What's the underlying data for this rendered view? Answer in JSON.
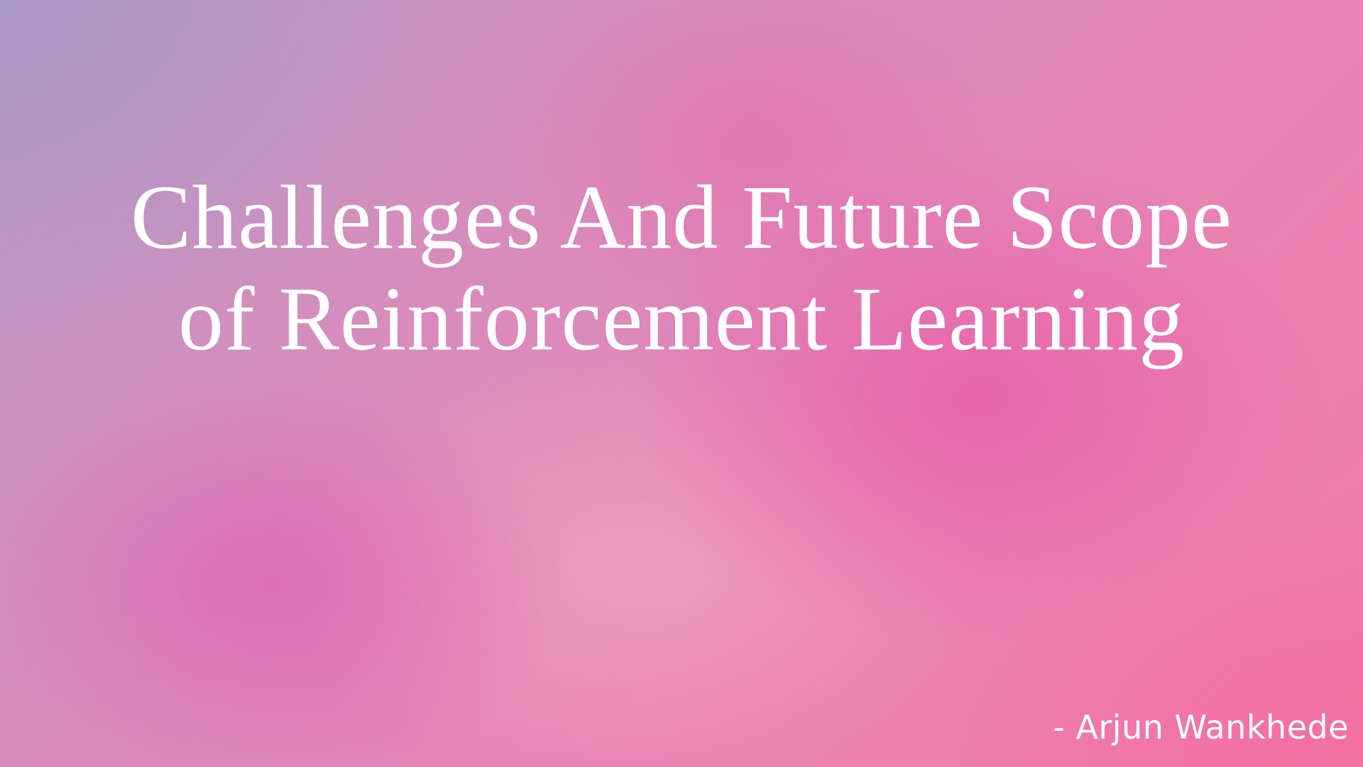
{
  "slide": {
    "title_line1": "Challenges And Future Scope",
    "title_line2": "of Reinforcement Learning",
    "author": "- Arjun Wankhede"
  },
  "colors": {
    "text": "#ffffff",
    "background_top_left": "#b99ac6",
    "background_center": "#e883b4",
    "background_bottom_right": "#f07aa8"
  }
}
